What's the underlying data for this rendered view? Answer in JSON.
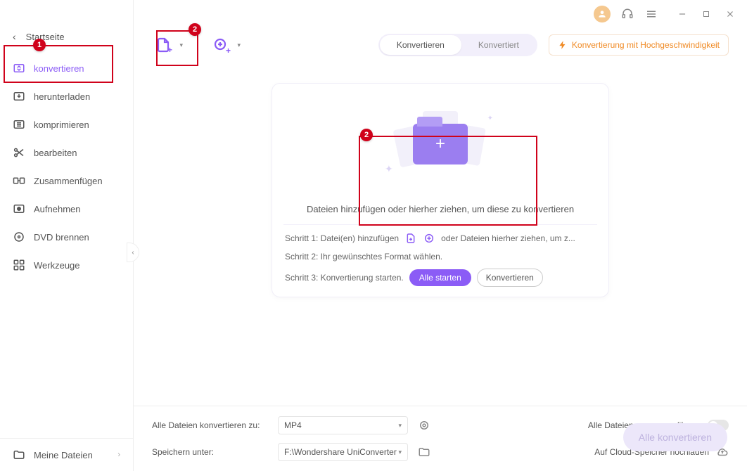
{
  "titlebar": {
    "avatar_icon": "user"
  },
  "sidebar": {
    "back_label": "Startseite",
    "items": [
      {
        "icon": "convert",
        "label": "konvertieren"
      },
      {
        "icon": "download",
        "label": "herunterladen"
      },
      {
        "icon": "compress",
        "label": "komprimieren"
      },
      {
        "icon": "scissors",
        "label": "bearbeiten"
      },
      {
        "icon": "merge",
        "label": "Zusammenfügen"
      },
      {
        "icon": "record",
        "label": "Aufnehmen"
      },
      {
        "icon": "disc",
        "label": "DVD brennen"
      },
      {
        "icon": "tools",
        "label": "Werkzeuge"
      }
    ],
    "bottom_label": "Meine Dateien"
  },
  "toolbar": {
    "seg_convert": "Konvertieren",
    "seg_converted": "Konvertiert",
    "speed_label": "Konvertierung mit Hochgeschwindigkeit"
  },
  "dropcard": {
    "caption": "Dateien hinzufügen oder hierher ziehen, um diese zu konvertieren",
    "step1_prefix": "Schritt 1: Datei(en) hinzufügen",
    "step1_suffix": "oder Dateien hierher ziehen, um z...",
    "step2": "Schritt 2: Ihr gewünschtes Format wählen.",
    "step3_prefix": "Schritt 3: Konvertierung starten.",
    "btn_start_all": "Alle starten",
    "btn_convert": "Konvertieren"
  },
  "footer": {
    "convert_to_label": "Alle Dateien konvertieren zu:",
    "convert_to_value": "MP4",
    "save_under_label": "Speichern unter:",
    "save_under_value": "F:\\Wondershare UniConverter",
    "merge_label": "Alle Dateien zusammenfügen:",
    "cloud_label": "Auf Cloud-Speicher hochladen",
    "convert_all_btn": "Alle konvertieren"
  },
  "callouts": {
    "c1": "1",
    "c2a": "2",
    "c2b": "2"
  },
  "colors": {
    "accent": "#8b5cf6",
    "orange": "#f08a24",
    "red": "#d0021b"
  }
}
